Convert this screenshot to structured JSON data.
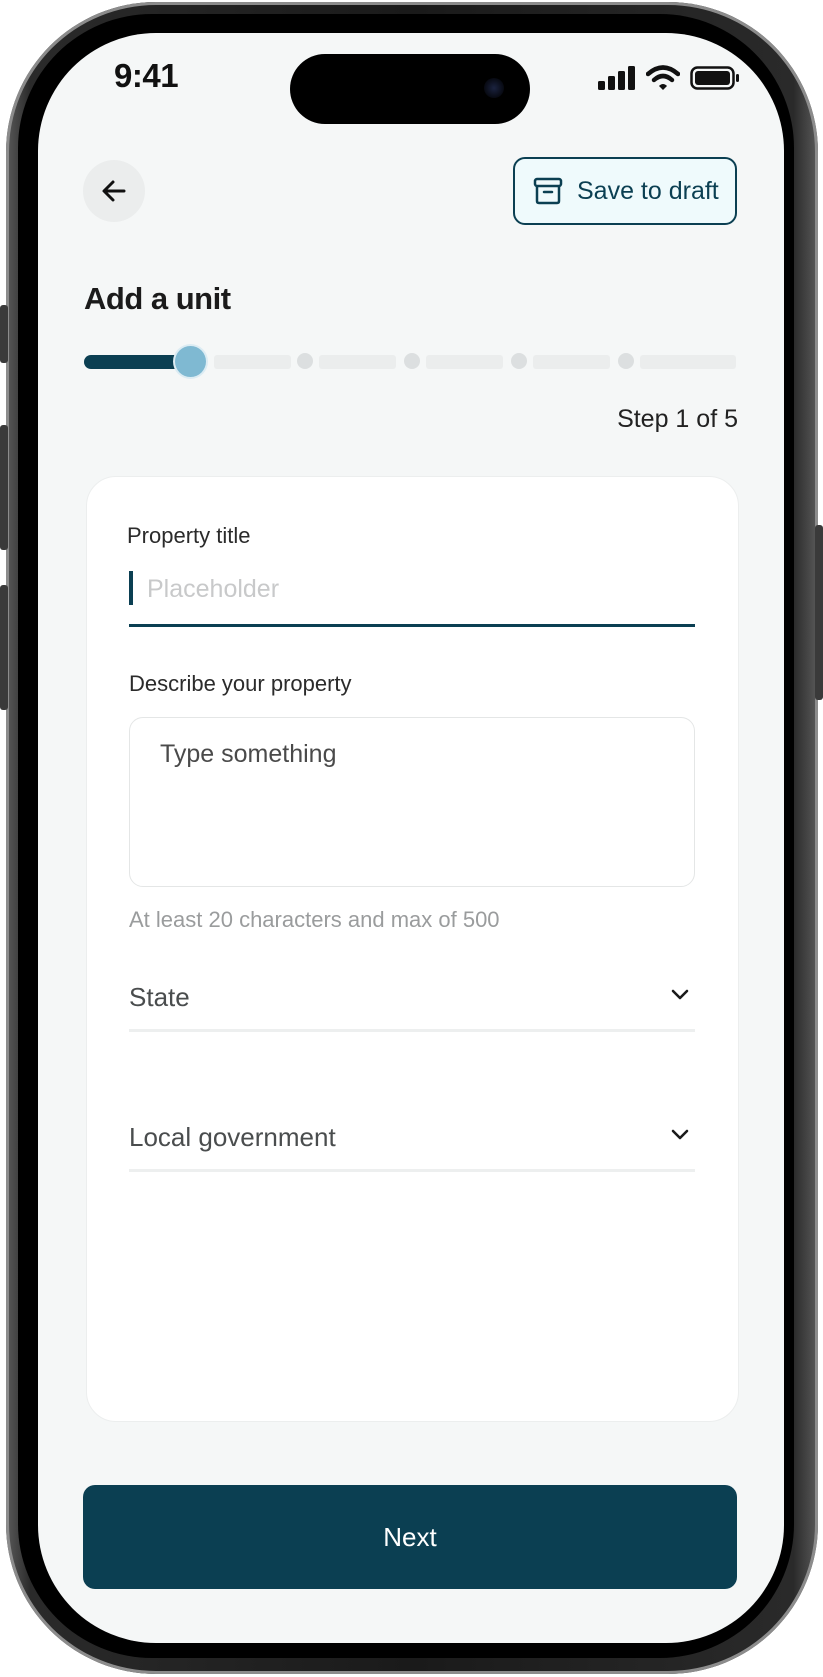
{
  "status_bar": {
    "time": "9:41"
  },
  "header": {
    "save_draft_label": "Save to draft"
  },
  "page": {
    "title": "Add a unit"
  },
  "stepper": {
    "current_step": 1,
    "total_steps": 5,
    "label": "Step 1 of 5"
  },
  "form": {
    "property_title": {
      "label": "Property title",
      "placeholder": "Placeholder",
      "value": ""
    },
    "description": {
      "label": "Describe your property",
      "placeholder": "Type something",
      "value": "",
      "helper": "At least 20 characters and max of 500"
    },
    "state": {
      "label": "State"
    },
    "local_government": {
      "label": "Local government"
    }
  },
  "footer": {
    "next_label": "Next"
  },
  "colors": {
    "primary": "#0b3f52",
    "step_indicator": "#7fb9d2",
    "background": "#f5f7f7"
  },
  "icons": {
    "back": "arrow-left-icon",
    "draft": "archive-box-icon",
    "dropdown": "chevron-down-icon"
  }
}
